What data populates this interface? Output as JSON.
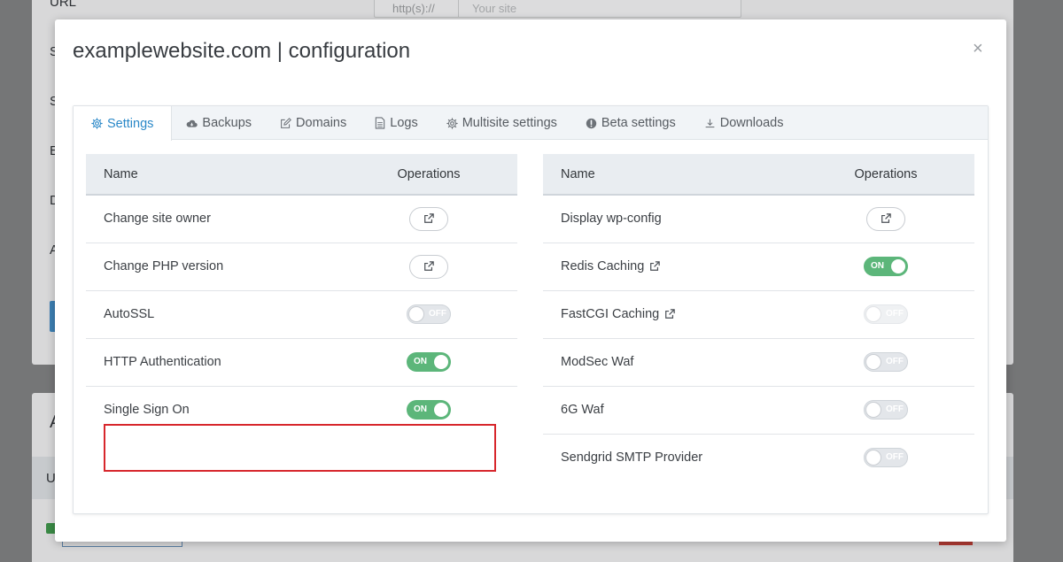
{
  "background": {
    "url_label": "URL",
    "url_prefix": "http(s)://",
    "url_placeholder": "Your site",
    "side_letters": [
      "S",
      "S",
      "E",
      "D",
      "A"
    ],
    "bottom_letter_a": "A",
    "bottom_letter_u": "U"
  },
  "modal": {
    "title": "examplewebsite.com | configuration",
    "close": "×"
  },
  "tabs": [
    {
      "label": "Settings",
      "icon": "gear-icon"
    },
    {
      "label": "Backups",
      "icon": "cloud-icon"
    },
    {
      "label": "Domains",
      "icon": "edit-icon"
    },
    {
      "label": "Logs",
      "icon": "file-icon"
    },
    {
      "label": "Multisite settings",
      "icon": "gear-icon"
    },
    {
      "label": "Beta settings",
      "icon": "alert-circle-icon"
    },
    {
      "label": "Downloads",
      "icon": "download-icon"
    }
  ],
  "left_table": {
    "headers": {
      "name": "Name",
      "operations": "Operations"
    },
    "rows": [
      {
        "name": "Change site owner",
        "type": "button"
      },
      {
        "name": "Change PHP version",
        "type": "button"
      },
      {
        "name": "AutoSSL",
        "type": "toggle",
        "state": "off",
        "label": "OFF"
      },
      {
        "name": "HTTP Authentication",
        "type": "toggle",
        "state": "on",
        "label": "ON"
      },
      {
        "name": "Single Sign On",
        "type": "toggle",
        "state": "on",
        "label": "ON"
      }
    ]
  },
  "right_table": {
    "headers": {
      "name": "Name",
      "operations": "Operations"
    },
    "rows": [
      {
        "name": "Display wp-config",
        "type": "button"
      },
      {
        "name": "Redis Caching",
        "type": "toggle",
        "state": "on",
        "label": "ON"
      },
      {
        "name": "FastCGI Caching",
        "type": "toggle",
        "state": "off",
        "label": "OFF"
      },
      {
        "name": "ModSec Waf",
        "type": "toggle",
        "state": "off",
        "label": "OFF"
      },
      {
        "name": "6G Waf",
        "type": "toggle",
        "state": "off",
        "label": "OFF"
      },
      {
        "name": "Sendgrid SMTP Provider",
        "type": "toggle",
        "state": "off",
        "label": "OFF"
      }
    ]
  },
  "colors": {
    "accent": "#2a88c8",
    "toggle_on": "#5cb67a",
    "highlight": "#d7272c"
  }
}
